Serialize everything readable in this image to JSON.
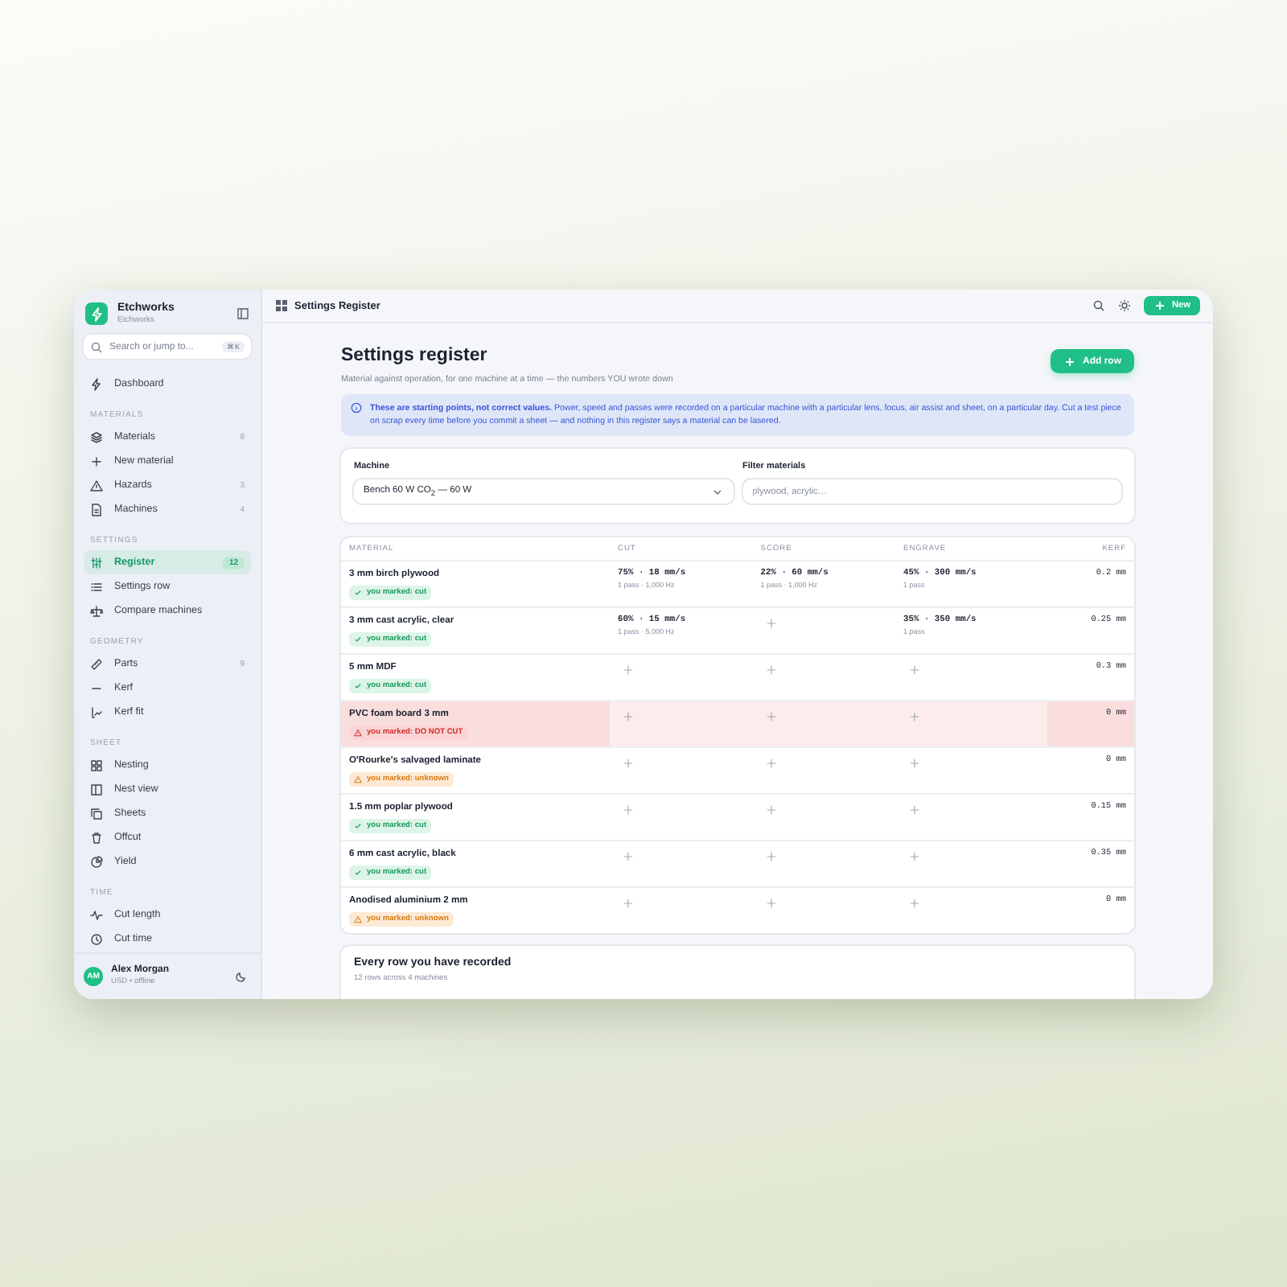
{
  "app": {
    "name": "Etchworks",
    "subtitle": "Etchworks"
  },
  "search": {
    "placeholder": "Search or jump to...",
    "shortcut": "⌘K"
  },
  "nav": [
    {
      "kind": "item",
      "label": "Dashboard",
      "selected": false
    },
    {
      "kind": "section",
      "label": "MATERIALS"
    },
    {
      "kind": "item",
      "label": "Materials",
      "count": "8",
      "selected": false
    },
    {
      "kind": "item",
      "label": "New material",
      "selected": false
    },
    {
      "kind": "item",
      "label": "Hazards",
      "count": "3",
      "selected": false
    },
    {
      "kind": "item",
      "label": "Machines",
      "count": "4",
      "selected": false
    },
    {
      "kind": "section",
      "label": "SETTINGS"
    },
    {
      "kind": "item",
      "label": "Register",
      "count": "12",
      "selected": true
    },
    {
      "kind": "item",
      "label": "Settings row",
      "selected": false
    },
    {
      "kind": "item",
      "label": "Compare machines",
      "selected": false
    },
    {
      "kind": "section",
      "label": "GEOMETRY"
    },
    {
      "kind": "item",
      "label": "Parts",
      "count": "9",
      "selected": false
    },
    {
      "kind": "item",
      "label": "Kerf",
      "selected": false
    },
    {
      "kind": "item",
      "label": "Kerf fit",
      "selected": false
    },
    {
      "kind": "section",
      "label": "SHEET"
    },
    {
      "kind": "item",
      "label": "Nesting",
      "selected": false
    },
    {
      "kind": "item",
      "label": "Nest view",
      "selected": false
    },
    {
      "kind": "item",
      "label": "Sheets",
      "selected": false
    },
    {
      "kind": "item",
      "label": "Offcut",
      "selected": false
    },
    {
      "kind": "item",
      "label": "Yield",
      "selected": false
    },
    {
      "kind": "section",
      "label": "TIME"
    },
    {
      "kind": "item",
      "label": "Cut length",
      "selected": false
    },
    {
      "kind": "item",
      "label": "Cut time",
      "selected": false
    }
  ],
  "user": {
    "initials": "AM",
    "name": "Alex Morgan",
    "meta": "USD • offline"
  },
  "topbar": {
    "title": "Settings Register",
    "new_button": "New"
  },
  "page": {
    "title": "Settings register",
    "subtitle": "Material against operation, for one machine at a time — the numbers YOU wrote down",
    "add_button": "Add row"
  },
  "notice": "**These are starting points, not correct values.** Power, speed and passes were recorded on a particular machine with a particular lens, focus, air assist and sheet, on a particular day. Cut a test piece on scrap every time before you commit a sheet — and nothing in this register says a material can be lasered.",
  "filters": {
    "machine_label": "Machine",
    "machine_value": "Bench 60 W CO$_{2}$ — 60 W",
    "filter_label": "Filter materials",
    "filter_placeholder": "plywood, acrylic…"
  },
  "table": {
    "columns": [
      "MATERIAL",
      "CUT",
      "SCORE",
      "ENGRAVE",
      "KERF"
    ],
    "rows": [
      {
        "material": "3 mm birch plywood",
        "badge": {
          "kind": "cut",
          "label": "you marked: cut"
        },
        "flagged": false,
        "cut": {
          "main": "75% · 18 mm/s",
          "sub": "1 pass · 1,000 Hz"
        },
        "score": {
          "main": "22% · 60 mm/s",
          "sub": "1 pass · 1,000 Hz"
        },
        "engrave": {
          "main": "45% · 300 mm/s",
          "sub": "1 pass"
        },
        "kerf": "0.2 mm"
      },
      {
        "material": "3 mm cast acrylic, clear",
        "badge": {
          "kind": "cut",
          "label": "you marked: cut"
        },
        "flagged": false,
        "cut": {
          "main": "60% · 15 mm/s",
          "sub": "1 pass · 5,000 Hz"
        },
        "score": null,
        "engrave": {
          "main": "35% · 350 mm/s",
          "sub": "1 pass"
        },
        "kerf": "0.25 mm"
      },
      {
        "material": "5 mm MDF",
        "badge": {
          "kind": "cut",
          "label": "you marked: cut"
        },
        "flagged": false,
        "cut": null,
        "score": null,
        "engrave": null,
        "kerf": "0.3 mm"
      },
      {
        "material": "PVC foam board 3 mm",
        "badge": {
          "kind": "danger",
          "label": "you marked: DO NOT CUT"
        },
        "flagged": true,
        "cut": null,
        "score": null,
        "engrave": null,
        "kerf": "0 mm"
      },
      {
        "material": "O'Rourke's salvaged laminate",
        "badge": {
          "kind": "unknown",
          "label": "you marked: unknown"
        },
        "flagged": false,
        "cut": null,
        "score": null,
        "engrave": null,
        "kerf": "0 mm"
      },
      {
        "material": "1.5 mm poplar plywood",
        "badge": {
          "kind": "cut",
          "label": "you marked: cut"
        },
        "flagged": false,
        "cut": null,
        "score": null,
        "engrave": null,
        "kerf": "0.15 mm"
      },
      {
        "material": "6 mm cast acrylic, black",
        "badge": {
          "kind": "cut",
          "label": "you marked: cut"
        },
        "flagged": false,
        "cut": null,
        "score": null,
        "engrave": null,
        "kerf": "0.35 mm"
      },
      {
        "material": "Anodised aluminium 2 mm",
        "badge": {
          "kind": "unknown",
          "label": "you marked: unknown"
        },
        "flagged": false,
        "cut": null,
        "score": null,
        "engrave": null,
        "kerf": "0 mm"
      }
    ]
  },
  "summary": {
    "title": "Every row you have recorded",
    "meta": "12 rows across 4 machines"
  }
}
